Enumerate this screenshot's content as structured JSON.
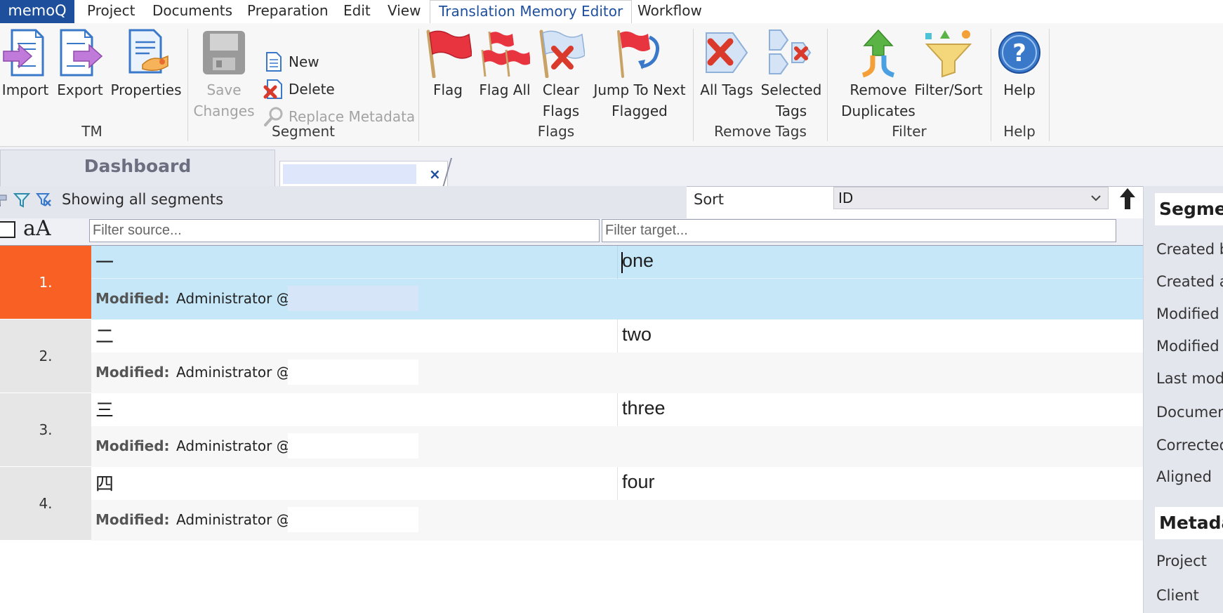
{
  "menubar": {
    "app": "memoQ",
    "items": [
      "Project",
      "Documents",
      "Preparation",
      "Edit",
      "View",
      "Translation Memory Editor",
      "Workflow"
    ],
    "active_index": 5
  },
  "ribbon": {
    "groups": {
      "tm": "TM",
      "segment": "Segment",
      "flags": "Flags",
      "remove_tags": "Remove Tags",
      "filter": "Filter",
      "help": "Help"
    },
    "buttons": {
      "import": "Import",
      "export": "Export",
      "properties": "Properties",
      "save_line1": "Save",
      "save_line2": "Changes",
      "new": "New",
      "delete": "Delete",
      "replace_metadata": "Replace Metadata",
      "flag": "Flag",
      "flag_all": "Flag All",
      "clear_line1": "Clear",
      "clear_line2": "Flags",
      "jump_line1": "Jump To Next",
      "jump_line2": "Flagged",
      "all_tags": "All Tags",
      "selected_line1": "Selected",
      "selected_line2": "Tags",
      "remove_dup_line1": "Remove",
      "remove_dup_line2": "Duplicates",
      "filter_sort": "Filter/Sort",
      "help": "Help"
    }
  },
  "tabs": {
    "dashboard": "Dashboard",
    "close": "×"
  },
  "filterbar": {
    "status": "Showing all segments",
    "sort_label": "Sort",
    "sort_value": "ID",
    "font_toggle": "aA",
    "source_placeholder": "Filter source...",
    "target_placeholder": "Filter target..."
  },
  "grid": {
    "modified_label": "Modified:",
    "rows": [
      {
        "num": "1.",
        "source": "一",
        "target": "one",
        "modified": "Administrator @2"
      },
      {
        "num": "2.",
        "source": "二",
        "target": "two",
        "modified": "Administrator @2"
      },
      {
        "num": "3.",
        "source": "三",
        "target": "three",
        "modified": "Administrator @2"
      },
      {
        "num": "4.",
        "source": "四",
        "target": "four",
        "modified": "Administrator @2"
      }
    ],
    "selected_index": 0
  },
  "right_panel": {
    "segment_header": "Segment",
    "segment_fields": [
      "Created by",
      "Created at",
      "Modified by",
      "Modified at",
      "Last modified",
      "Document",
      "Corrected",
      "Aligned"
    ],
    "metadata_header": "Metadata",
    "metadata_fields": [
      "Project",
      "Client"
    ]
  },
  "colors": {
    "accent": "#1e4f9c",
    "selected_row": "#c6e7f8",
    "row_number_selected": "#f96124"
  }
}
